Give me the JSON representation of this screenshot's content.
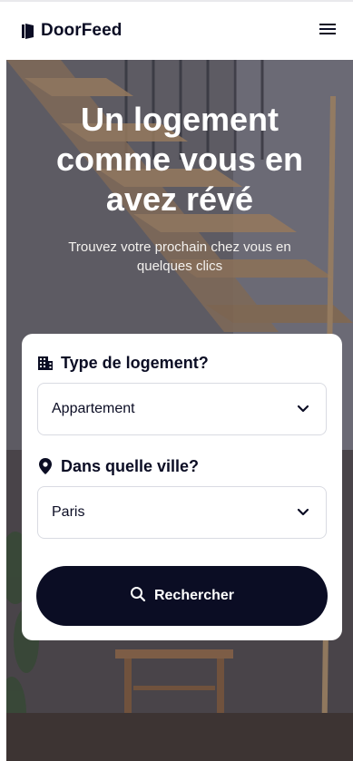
{
  "brand": {
    "name": "DoorFeed"
  },
  "header": {
    "menu_icon": "hamburger-menu-icon"
  },
  "hero": {
    "title": "Un logement comme vous en avez révé",
    "subtitle": "Trouvez votre prochain chez vous en quelques clics"
  },
  "search": {
    "type_label": "Type de logement?",
    "type_icon": "building-icon",
    "type_value": "Appartement",
    "city_label": "Dans quelle ville?",
    "city_icon": "map-pin-icon",
    "city_value": "Paris",
    "button_label": "Rechercher",
    "button_icon": "search-icon"
  },
  "colors": {
    "brand_dark": "#0b0d24",
    "border": "#d9dbe2",
    "white": "#ffffff"
  }
}
